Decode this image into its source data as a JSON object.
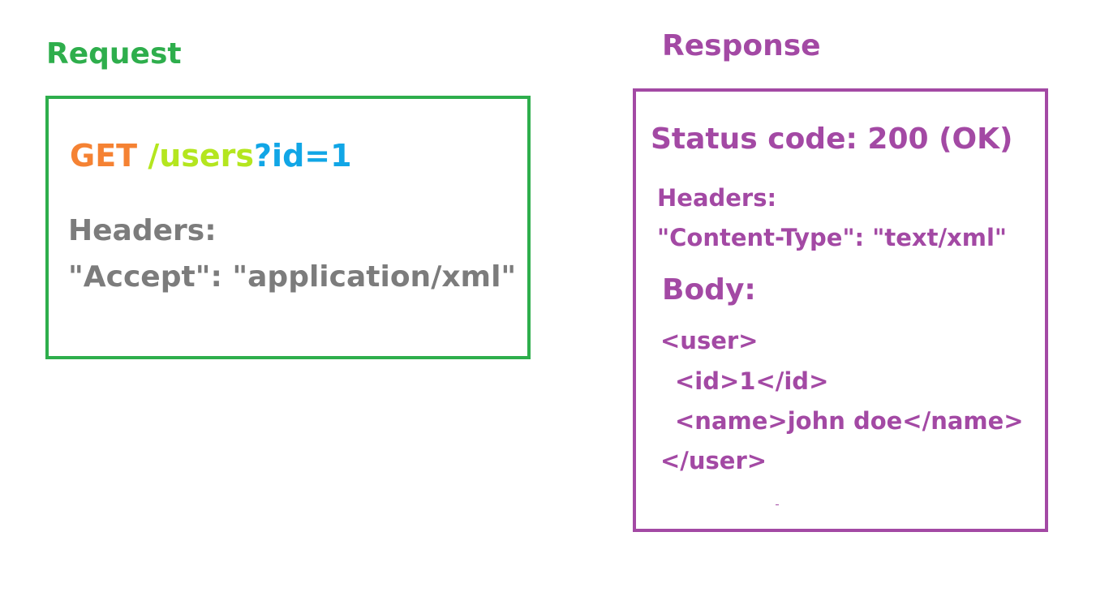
{
  "request": {
    "title": "Request",
    "method": "GET",
    "path": "/users",
    "query": "?id=1",
    "headers_label": "Headers:",
    "header_line": "\"Accept\": \"application/xml\"",
    "colors": {
      "title": "#2eae4c",
      "border": "#2eae4c",
      "method": "#f58233",
      "path": "#b4e61f",
      "query": "#11a6e6",
      "headers": "#7c7c7c"
    }
  },
  "response": {
    "title": "Response",
    "status": "Status code: 200 (OK)",
    "headers_label": "Headers:",
    "header_line": "\"Content-Type\": \"text/xml\"",
    "body_label": "Body:",
    "body_lines": [
      "<user>",
      "<id>1</id>",
      "<name>john doe</name>",
      "</user>"
    ],
    "colors": {
      "text": "#a349a4",
      "border": "#a349a4"
    }
  }
}
